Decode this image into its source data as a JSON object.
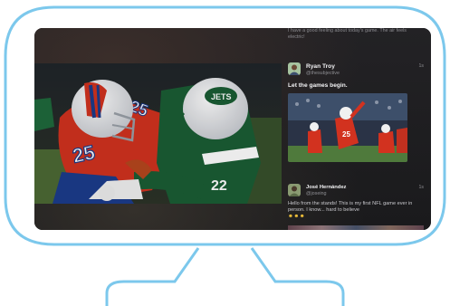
{
  "feed": {
    "top_snippet": "I have a good feeling about today's game. The air feels electric!",
    "tweets": [
      {
        "name": "Ryan Troy",
        "handle": "@thesubjective",
        "time": "1s",
        "text": "Let the games begin."
      },
      {
        "name": "José Hernández",
        "handle": "@joseing",
        "time": "1s",
        "text": "Hello from the stands! This is my first NFL game ever in person. I know... hard to believe",
        "emoji": "☻☻☻"
      }
    ]
  },
  "video": {
    "player_numbers": [
      "25",
      "25",
      "22"
    ],
    "helmet_logo": "JETS"
  },
  "colors": {
    "monitor_outline": "#7cc8ec",
    "bills_red": "#d2321f",
    "bills_blue": "#1c3c8c",
    "jets_green": "#1b5e35",
    "screen_bg": "#1b1b1d"
  }
}
